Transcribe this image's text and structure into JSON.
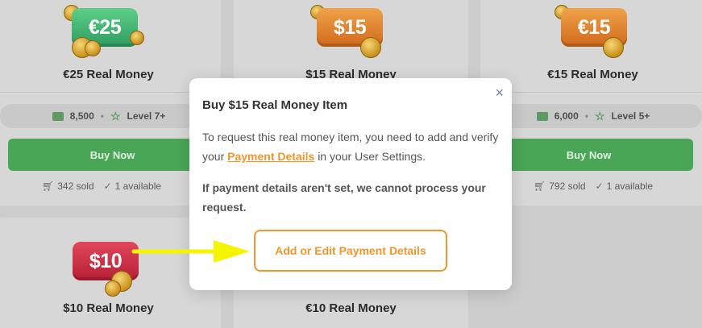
{
  "cards": [
    {
      "badge": "€25",
      "title": "€25 Real Money",
      "points": "8,500",
      "level": "Level 7+",
      "buy": "Buy Now",
      "sold": "342 sold",
      "available": "1 available",
      "color": "#3aaa6e"
    },
    {
      "badge": "$15",
      "title": "$15 Real Money",
      "color": "#e07f2b"
    },
    {
      "badge": "€15",
      "title": "€15 Real Money",
      "points": "6,000",
      "level": "Level 5+",
      "buy": "Buy Now",
      "sold": "792 sold",
      "available": "1 available",
      "color": "#e07f2b"
    },
    {
      "badge": "$10",
      "title": "$10 Real Money",
      "color": "#cf2f47"
    },
    {
      "title": "€10 Real Money"
    }
  ],
  "modal": {
    "title": "Buy $15 Real Money Item",
    "body_pre": "To request this real money item, you need to add and verify your",
    "link": "Payment Details",
    "body_post": "in your User Settings.",
    "warning": "If payment details aren't set, we cannot process your request.",
    "button": "Add or Edit Payment Details",
    "close": "×"
  },
  "colors": {
    "accent": "#f0962a",
    "buy_green": "#4aa657",
    "arrow": "#f5f500"
  },
  "icons": [
    "info-icon",
    "money-icon",
    "star-icon",
    "cart-icon",
    "check-circle-icon",
    "close-icon",
    "arrow-icon"
  ]
}
